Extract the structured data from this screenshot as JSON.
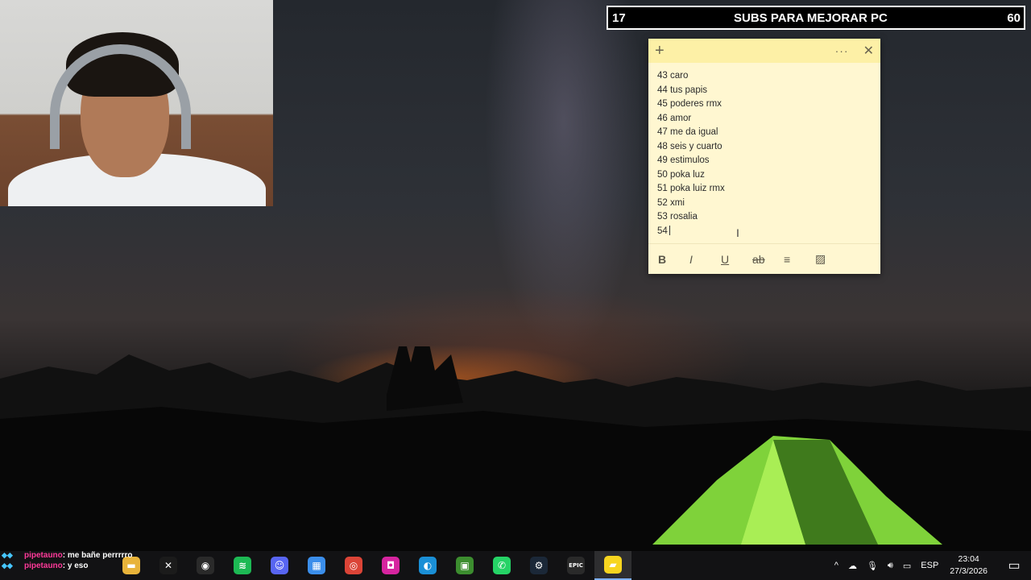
{
  "subs": {
    "current": "17",
    "label": "SUBS PARA MEJORAR PC",
    "goal": "60"
  },
  "sticky": {
    "lines": [
      "43 caro",
      "44 tus papis",
      "45 poderes rmx",
      "46 amor",
      "47 me da igual",
      "48 seis y cuarto",
      "49 estimulos",
      "50 poka luz",
      "51 poka luiz rmx",
      "52 xmi",
      "53 rosalia",
      "54"
    ],
    "add_icon": "+",
    "more_icon": "···",
    "close_icon": "✕",
    "toolbar": {
      "bold": "B",
      "italic": "I",
      "underline": "U",
      "strike": "ab",
      "list": "≡",
      "image": "▨"
    }
  },
  "chat": [
    {
      "user": "pipetauno",
      "message": ": me bañe perrrrro"
    },
    {
      "user": "pipetauno",
      "message": ": y eso"
    }
  ],
  "taskbar": {
    "apps": [
      {
        "name": "file-explorer",
        "glyph": "▬",
        "color": "#e8b33a"
      },
      {
        "name": "capcut",
        "glyph": "✕",
        "color": "#1b1b1b"
      },
      {
        "name": "obs",
        "glyph": "◉",
        "color": "#2a2a2a"
      },
      {
        "name": "spotify",
        "glyph": "≋",
        "color": "#1db954"
      },
      {
        "name": "discord",
        "glyph": "☺",
        "color": "#5865f2"
      },
      {
        "name": "store",
        "glyph": "▦",
        "color": "#3b8eea"
      },
      {
        "name": "chrome",
        "glyph": "◎",
        "color": "#db4437"
      },
      {
        "name": "instagram",
        "glyph": "◘",
        "color": "#d6249f"
      },
      {
        "name": "edge",
        "glyph": "◐",
        "color": "#1a8fd6"
      },
      {
        "name": "minecraft",
        "glyph": "▣",
        "color": "#3c8d2f"
      },
      {
        "name": "whatsapp",
        "glyph": "✆",
        "color": "#25d366"
      },
      {
        "name": "steam",
        "glyph": "⚙",
        "color": "#1b2838"
      },
      {
        "name": "epic-games",
        "glyph": "EPIC",
        "color": "#2a2a2a"
      },
      {
        "name": "sticky-notes",
        "glyph": "▰",
        "color": "#f7d51f"
      }
    ],
    "tray": {
      "chevron": "^",
      "language": "ESP",
      "time": "23:04",
      "date": "27/3/2026",
      "notification": "▭"
    }
  }
}
